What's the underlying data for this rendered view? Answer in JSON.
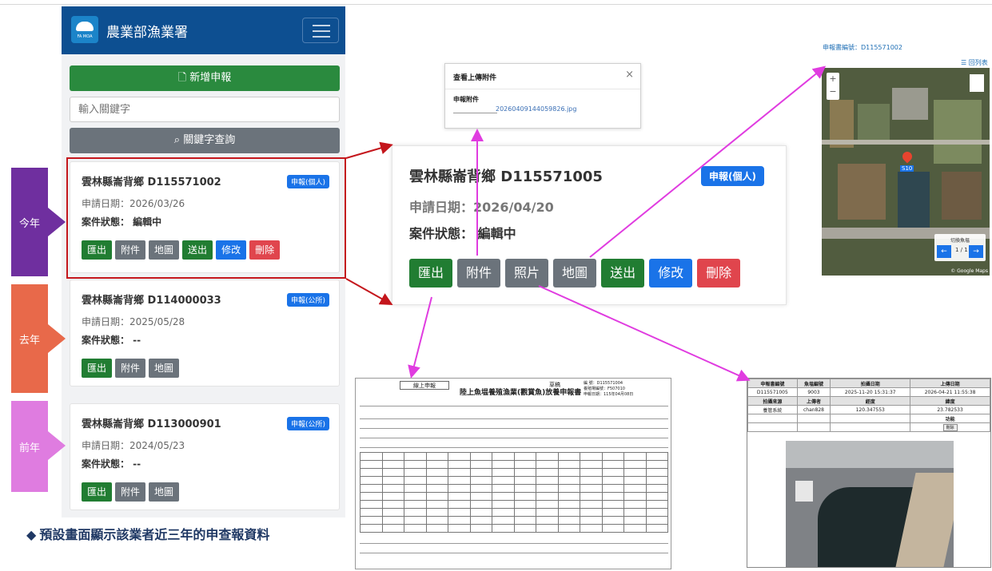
{
  "app": {
    "title": "農業部漁業署",
    "logo_text": "FA MOA"
  },
  "toolbar": {
    "new_label": "新增申報",
    "search_placeholder": "輸入關鍵字",
    "search_label": "關鍵字查詢"
  },
  "cards": [
    {
      "id": "雲林縣崙背鄉 D115571002",
      "badge": "申報(個人)",
      "date": "申請日期：2026/03/26",
      "status": "案件狀態： 編輯中",
      "actions": [
        "匯出",
        "附件",
        "地圖",
        "送出",
        "修改",
        "刪除"
      ]
    },
    {
      "id": "雲林縣崙背鄉 D114000033",
      "badge": "申報(公所)",
      "date": "申請日期：2025/05/28",
      "status": "案件狀態： --",
      "actions": [
        "匯出",
        "附件",
        "地圖"
      ]
    },
    {
      "id": "雲林縣崙背鄉 D113000901",
      "badge": "申報(公所)",
      "date": "申請日期：2024/05/23",
      "status": "案件狀態： --",
      "actions": [
        "匯出",
        "附件",
        "地圖"
      ]
    }
  ],
  "side_tags": [
    "今年",
    "去年",
    "前年"
  ],
  "note": "預設畫面顯示該業者近三年的申查報資料",
  "modal": {
    "title": "查看上傳附件",
    "close": "×",
    "label": "申報附件",
    "file": "20260409144059826.jpg"
  },
  "zoom_card": {
    "id": "雲林縣崙背鄉 D115571005",
    "badge": "申報(個人)",
    "date": "申請日期：2026/04/20",
    "status": "案件狀態： 編輯中",
    "actions": [
      "匯出",
      "附件",
      "照片",
      "地圖",
      "送出",
      "修改",
      "刪除"
    ]
  },
  "map": {
    "title": "申報書編號：D115571002",
    "back": "回列表",
    "pin_label": "S10",
    "switch_label": "切換魚塭",
    "page": "1 / 1",
    "credit": "© Google Maps"
  },
  "form": {
    "stamp": "線上申報",
    "title": "陸上魚塭養殖漁業(觀賞魚)放養申報書",
    "draft": "草稿",
    "meta": [
      "編 號：D115571004",
      "養殖場編號：F507010",
      "申報日期：115年04月08日"
    ]
  },
  "photo": {
    "head1": [
      "申報書編號",
      "魚塭編號",
      "拍攝日期",
      "上傳日期"
    ],
    "row1": [
      "D115571005",
      "9003",
      "2025-11-20 15:31:37",
      "2026-04-21 11:55:38"
    ],
    "head2": [
      "拍攝來源",
      "上傳者",
      "經度",
      "緯度"
    ],
    "row2": [
      "養管系統",
      "chan828",
      "120.347553",
      "23.782533"
    ],
    "func_label": "功能",
    "delete": "刪除"
  }
}
